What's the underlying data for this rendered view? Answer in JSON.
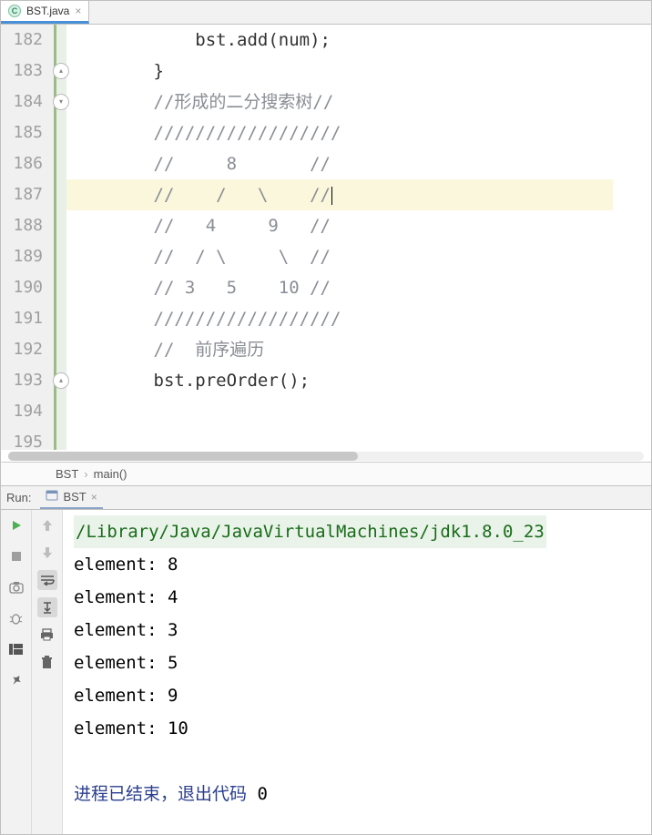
{
  "tab": {
    "filename": "BST.java"
  },
  "editor": {
    "lines": [
      {
        "num": 182,
        "indent": "            ",
        "text": "bst.add(num);",
        "cls": ""
      },
      {
        "num": 183,
        "indent": "        ",
        "text": "}",
        "cls": ""
      },
      {
        "num": 184,
        "indent": "        ",
        "text": "//形成的二分搜索树//",
        "cls": "comment"
      },
      {
        "num": 185,
        "indent": "        ",
        "text": "//////////////////",
        "cls": "comment"
      },
      {
        "num": 186,
        "indent": "        ",
        "text": "//     8       //",
        "cls": "comment"
      },
      {
        "num": 187,
        "indent": "        ",
        "text": "//    /   \\    //",
        "cls": "comment",
        "hl": true,
        "caret": true
      },
      {
        "num": 188,
        "indent": "        ",
        "text": "//   4     9   //",
        "cls": "comment"
      },
      {
        "num": 189,
        "indent": "        ",
        "text": "//  / \\     \\  //",
        "cls": "comment"
      },
      {
        "num": 190,
        "indent": "        ",
        "text": "// 3   5    10 //",
        "cls": "comment"
      },
      {
        "num": 191,
        "indent": "        ",
        "text": "//////////////////",
        "cls": "comment"
      },
      {
        "num": 192,
        "indent": "",
        "text": "",
        "cls": ""
      },
      {
        "num": 193,
        "indent": "        ",
        "text": "//  前序遍历",
        "cls": "comment"
      },
      {
        "num": 194,
        "indent": "        ",
        "text": "bst.preOrder();",
        "cls": ""
      },
      {
        "num": 195,
        "indent": "",
        "text": "",
        "cls": ""
      }
    ],
    "folds": [
      {
        "row": 1,
        "dir": "up"
      },
      {
        "row": 2,
        "dir": "down"
      },
      {
        "row": 11,
        "dir": "up"
      }
    ]
  },
  "breadcrumb": {
    "class": "BST",
    "method": "main()"
  },
  "run": {
    "label": "Run:",
    "config": "BST"
  },
  "console": {
    "path": "/Library/Java/JavaVirtualMachines/jdk1.8.0_23",
    "outputs": [
      "element: 8",
      "element: 4",
      "element: 3",
      "element: 5",
      "element: 9",
      "element: 10"
    ],
    "exit_text": "进程已结束，退出代码 ",
    "exit_code": "0"
  },
  "icons": {
    "run": "run-icon",
    "stop": "stop-icon",
    "camera": "camera-icon",
    "bug": "bug-icon",
    "layout": "layout-icon",
    "pin": "pin-icon",
    "up": "up-arrow-icon",
    "down": "down-arrow-icon",
    "wrap": "soft-wrap-icon",
    "scroll": "scroll-to-end-icon",
    "print": "print-icon",
    "trash": "trash-icon"
  }
}
